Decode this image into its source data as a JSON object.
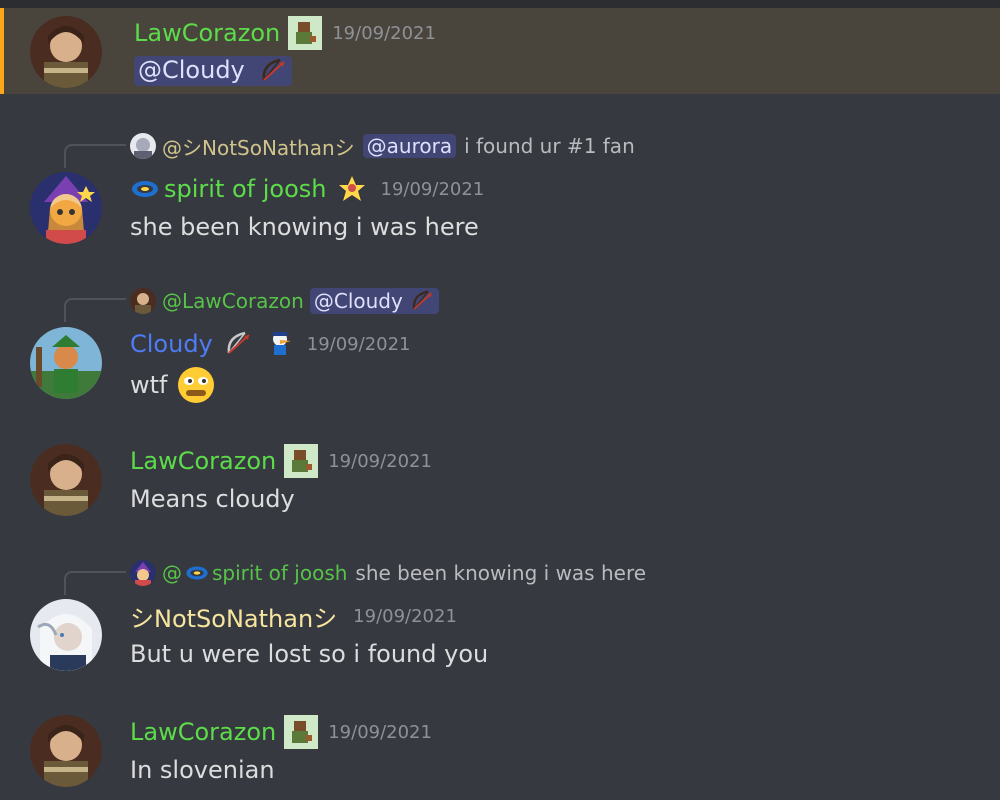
{
  "colors": {
    "green": "#5ddc4a",
    "blue": "#4d7cf5",
    "nathan": "#f7e59f",
    "timestamp": "#8e9297",
    "text": "#dcddde",
    "mention_bg": "#414675",
    "highlight_bg": "#49443c",
    "highlight_border": "#faa81a"
  },
  "messages": [
    {
      "author": "LawCorazon",
      "timestamp": "19/09/2021",
      "content": "@Cloudy"
    },
    {
      "reply": {
        "author": "@シNotSoNathanシ",
        "mention": "@aurora",
        "text": "i found ur #1 fan"
      },
      "author": "spirit of joosh",
      "timestamp": "19/09/2021",
      "content": "she been knowing i was here"
    },
    {
      "reply": {
        "author": "@LawCorazon",
        "mention": "@Cloudy"
      },
      "author": "Cloudy",
      "timestamp": "19/09/2021",
      "content": "wtf"
    },
    {
      "author": "LawCorazon",
      "timestamp": "19/09/2021",
      "content": "Means cloudy"
    },
    {
      "reply": {
        "author_prefix": "@",
        "author": "spirit of joosh",
        "text": "she been knowing i was here"
      },
      "author": "シNotSoNathanシ",
      "timestamp": "19/09/2021",
      "content": "But u were lost so i found you"
    },
    {
      "author": "LawCorazon",
      "timestamp": "19/09/2021",
      "content": "In slovenian"
    }
  ]
}
